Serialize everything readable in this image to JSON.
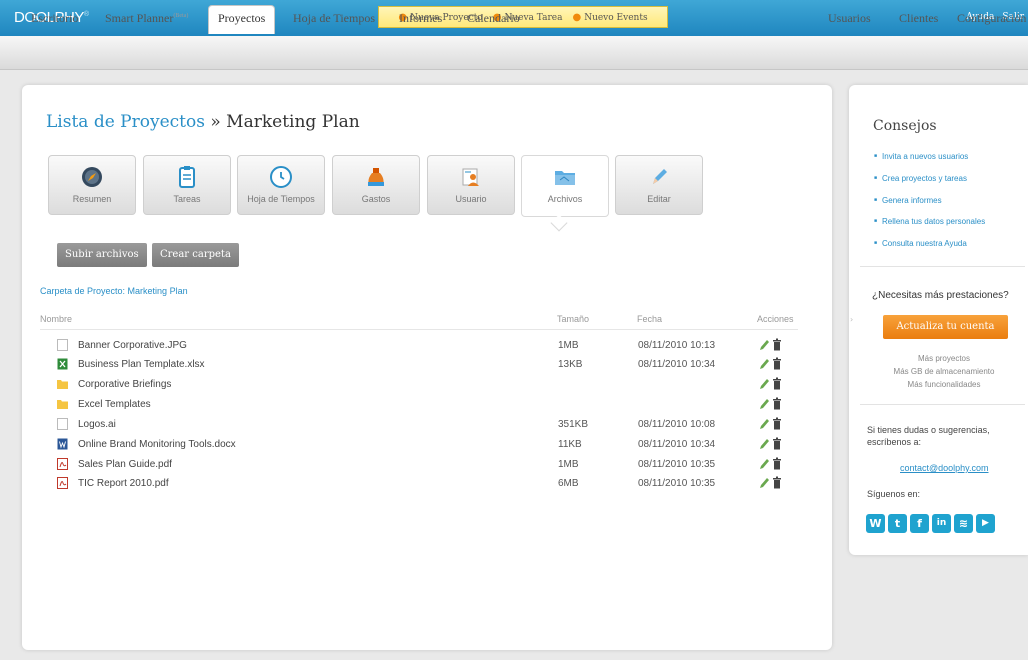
{
  "app": {
    "logo": "DOOLPHY",
    "logo_mark": "®"
  },
  "quick_actions": [
    "Nueva Proyecto",
    "Nueva Tarea",
    "Nuevo Events"
  ],
  "top_links": [
    "Ayuda",
    "Salir"
  ],
  "nav": {
    "left": [
      {
        "label": "Escritorio"
      },
      {
        "label": "Smart Planner",
        "badge": "(Beta)"
      },
      {
        "label": "Proyectos",
        "active": true
      },
      {
        "label": "Hoja de Tiempos"
      },
      {
        "label": "Informes"
      },
      {
        "label": "Calendario"
      }
    ],
    "right": [
      "Usuarios",
      "Clientes",
      "Configuración"
    ]
  },
  "breadcrumb": {
    "link": "Lista de Proyectos",
    "separator": "»",
    "current": "Marketing Plan"
  },
  "tabs": [
    {
      "label": "Resumen",
      "icon": "compass-icon"
    },
    {
      "label": "Tareas",
      "icon": "clipboard-icon"
    },
    {
      "label": "Hoja de Tiempos",
      "icon": "clock-icon"
    },
    {
      "label": "Gastos",
      "icon": "money-bag-icon"
    },
    {
      "label": "Usuario",
      "icon": "users-icon"
    },
    {
      "label": "Archivos",
      "icon": "folder-icon",
      "active": true
    },
    {
      "label": "Editar",
      "icon": "pencil-icon"
    }
  ],
  "buttons": {
    "upload": "Subir archivos",
    "create_folder": "Crear carpeta"
  },
  "folder_path": "Carpeta de Proyecto: Marketing Plan",
  "table": {
    "headers": {
      "name": "Nombre",
      "size": "Tamaño",
      "date": "Fecha",
      "actions": "Acciones"
    },
    "rows": [
      {
        "name": "Banner Corporative.JPG",
        "type": "image",
        "size": "1MB",
        "date": "08/11/2010 10:13"
      },
      {
        "name": "Business Plan Template.xlsx",
        "type": "excel",
        "size": "13KB",
        "date": "08/11/2010 10:34"
      },
      {
        "name": "Corporative Briefings",
        "type": "folder",
        "size": "",
        "date": ""
      },
      {
        "name": "Excel Templates",
        "type": "folder",
        "size": "",
        "date": ""
      },
      {
        "name": "Logos.ai",
        "type": "file",
        "size": "351KB",
        "date": "08/11/2010 10:08"
      },
      {
        "name": "Online Brand Monitoring Tools.docx",
        "type": "word",
        "size": "11KB",
        "date": "08/11/2010 10:34"
      },
      {
        "name": "Sales Plan Guide.pdf",
        "type": "pdf",
        "size": "1MB",
        "date": "08/11/2010 10:35"
      },
      {
        "name": "TIC Report 2010.pdf",
        "type": "pdf",
        "size": "6MB",
        "date": "08/11/2010 10:35"
      }
    ]
  },
  "sidebar": {
    "title": "Consejos",
    "tips": [
      "Invita a nuevos usuarios",
      "Crea proyectos y tareas",
      "Genera informes",
      "Rellena tus datos personales",
      "Consulta nuestra Ayuda"
    ],
    "need_more": "¿Necesitas más prestaciones?",
    "upgrade": "Actualiza tu cuenta",
    "perks": [
      "Más proyectos",
      "Más GB de almacenamiento",
      "Más funcionalidades"
    ],
    "questions": "Si tienes dudas o sugerencias, escríbenos a:",
    "email": "contact@doolphy.com",
    "follow": "Síguenos en:",
    "social": [
      {
        "icon": "wordpress-icon",
        "glyph": "W"
      },
      {
        "icon": "twitter-icon",
        "glyph": "t"
      },
      {
        "icon": "facebook-icon",
        "glyph": "f"
      },
      {
        "icon": "linkedin-icon",
        "glyph": "in"
      },
      {
        "icon": "rss-icon",
        "glyph": "≋"
      },
      {
        "icon": "youtube-icon",
        "glyph": "▶"
      }
    ]
  },
  "colors": {
    "brand": "#2a8fc7",
    "accent": "#ea7d0f",
    "topbar": "#1f86bf"
  }
}
